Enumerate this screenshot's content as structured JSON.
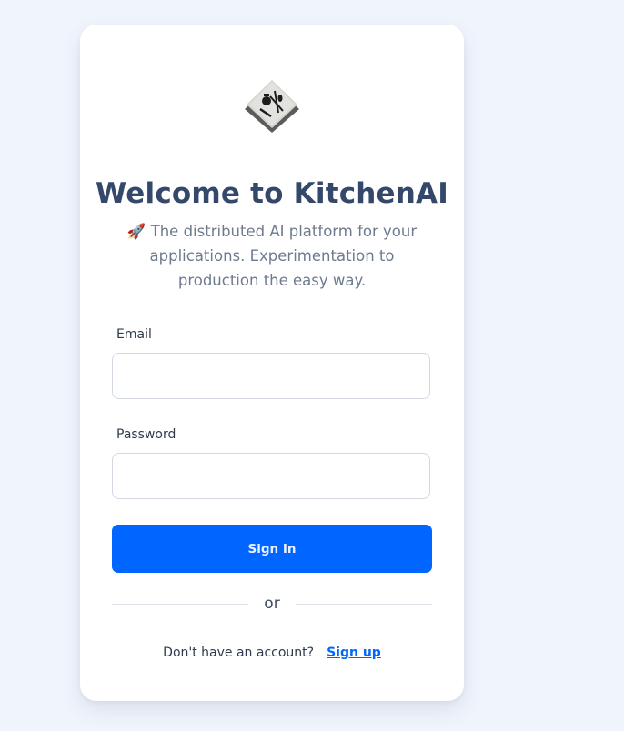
{
  "logo": {
    "icon": "kitchen-utensils-tile-icon"
  },
  "header": {
    "title": "Welcome to KitchenAI",
    "subtitle": "🚀 The distributed AI platform for your applications. Experimentation to production the easy way."
  },
  "form": {
    "email_label": "Email",
    "email_value": "",
    "password_label": "Password",
    "password_value": "",
    "submit_label": "Sign In"
  },
  "divider": {
    "text": "or"
  },
  "footer": {
    "prompt": "Don't have an account?",
    "signup_label": "Sign up"
  },
  "colors": {
    "background": "#f0f5fd",
    "accent": "#0066ff",
    "title": "#34496a",
    "subtitle": "#6e7b8f"
  }
}
